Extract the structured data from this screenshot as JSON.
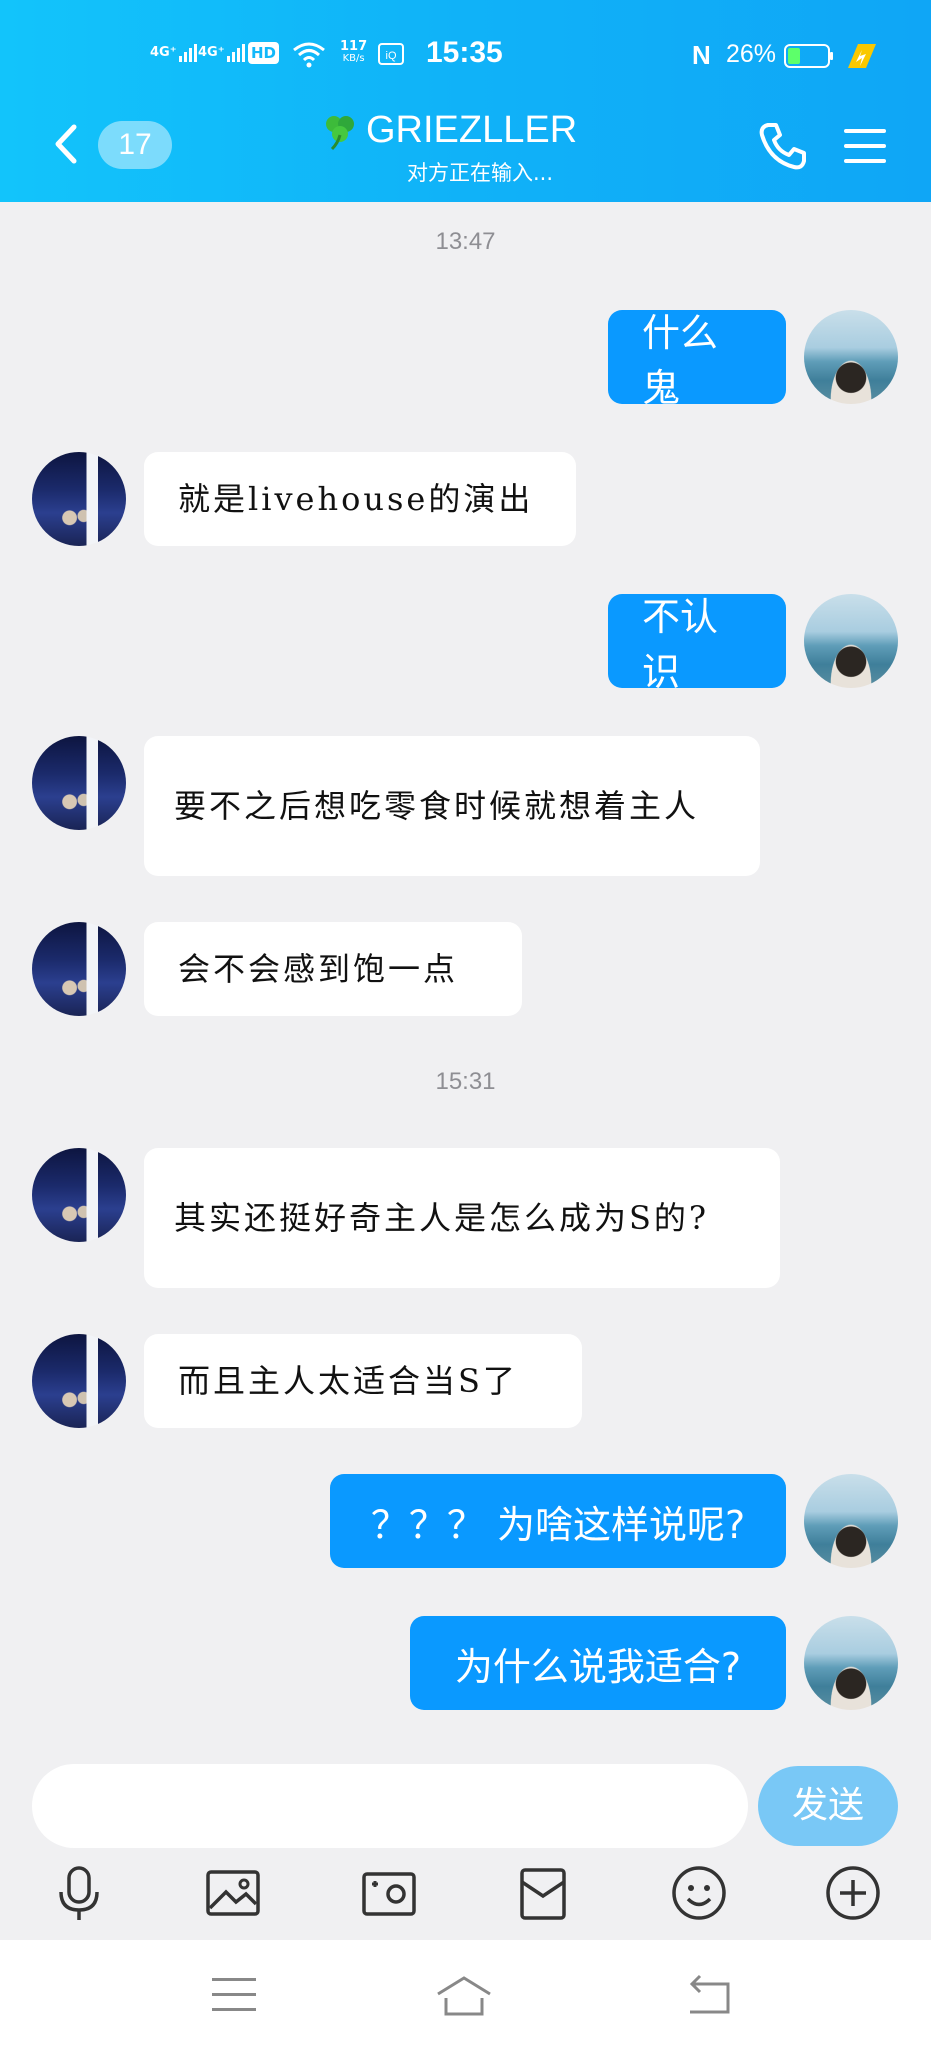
{
  "status_bar": {
    "network1": "4G⁺",
    "network2": "4G⁺",
    "hd": "HD",
    "speed": "117",
    "speed_unit": "KB/s",
    "time": "15:35",
    "nfc": "N",
    "battery": "26%"
  },
  "header": {
    "unread_count": "17",
    "title_icon": "clover",
    "title": "GRIEZLLER",
    "subtitle": "对方正在输入..."
  },
  "messages": [
    {
      "type": "time",
      "text": "13:47"
    },
    {
      "type": "msg",
      "side": "self",
      "text": "什么鬼"
    },
    {
      "type": "msg",
      "side": "other",
      "text": "就是livehouse的演出"
    },
    {
      "type": "msg",
      "side": "self",
      "text": "不认识"
    },
    {
      "type": "msg",
      "side": "other",
      "text": "要不之后想吃零食时候就想着主人"
    },
    {
      "type": "msg",
      "side": "other",
      "text": "会不会感到饱一点"
    },
    {
      "type": "time",
      "text": "15:31"
    },
    {
      "type": "msg",
      "side": "other",
      "text": "其实还挺好奇主人是怎么成为S的?"
    },
    {
      "type": "msg",
      "side": "other",
      "text": "而且主人太适合当S了"
    },
    {
      "type": "msg",
      "side": "self",
      "text": "？？？ 为啥这样说呢?"
    },
    {
      "type": "msg",
      "side": "self",
      "text": "为什么说我适合?"
    }
  ],
  "input": {
    "value": "",
    "placeholder": "",
    "send_label": "发送"
  },
  "toolbar": [
    "microphone-icon",
    "image-icon",
    "camera-icon",
    "red-packet-icon",
    "emoji-icon",
    "plus-icon"
  ],
  "colors": {
    "header_start": "#12c4fb",
    "header_end": "#0fa6f6",
    "self_bubble": "#0a99ff",
    "other_bubble": "#ffffff",
    "background": "#f0f0f2",
    "send_button": "#79c8f6"
  }
}
